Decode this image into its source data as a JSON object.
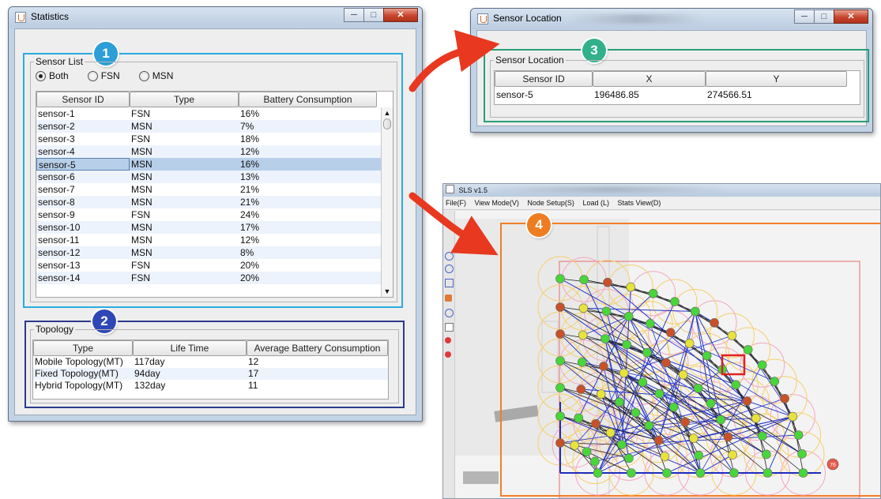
{
  "colors": {
    "highlight_1": "#29abe2",
    "highlight_2": "#2b3a8c",
    "highlight_3": "#2a9d78",
    "highlight_4": "#f07f27",
    "badge_1": "#2c9ed8",
    "badge_2": "#2f47b6",
    "badge_3": "#31b08a",
    "badge_4": "#ee7d22",
    "arrow": "#e8381f",
    "selected_row": "#b8cfe9"
  },
  "statistics": {
    "title": "Statistics",
    "sensor_list": {
      "label": "Sensor List",
      "badge": "1",
      "filter_options": [
        "Both",
        "FSN",
        "MSN"
      ],
      "selected_filter": "Both",
      "columns": [
        "Sensor ID",
        "Type",
        "Battery Consumption"
      ],
      "rows": [
        [
          "sensor-1",
          "FSN",
          "16%"
        ],
        [
          "sensor-2",
          "MSN",
          "7%"
        ],
        [
          "sensor-3",
          "FSN",
          "18%"
        ],
        [
          "sensor-4",
          "MSN",
          "12%"
        ],
        [
          "sensor-5",
          "MSN",
          "16%"
        ],
        [
          "sensor-6",
          "MSN",
          "13%"
        ],
        [
          "sensor-7",
          "MSN",
          "21%"
        ],
        [
          "sensor-8",
          "MSN",
          "21%"
        ],
        [
          "sensor-9",
          "FSN",
          "24%"
        ],
        [
          "sensor-10",
          "MSN",
          "17%"
        ],
        [
          "sensor-11",
          "MSN",
          "12%"
        ],
        [
          "sensor-12",
          "MSN",
          "8%"
        ],
        [
          "sensor-13",
          "FSN",
          "20%"
        ],
        [
          "sensor-14",
          "FSN",
          "20%"
        ]
      ],
      "selected_row_index": 4
    },
    "topology": {
      "label": "Topology",
      "badge": "2",
      "columns": [
        "Type",
        "Life Time",
        "Average Battery Consumption"
      ],
      "rows": [
        [
          "Mobile Topology(MT)",
          "117day",
          "12"
        ],
        [
          "Fixed Topology(MT)",
          "94day",
          "17"
        ],
        [
          "Hybrid Topology(MT)",
          "132day",
          "11"
        ]
      ]
    }
  },
  "sensor_location": {
    "title": "Sensor Location",
    "group_label": "Sensor Location",
    "badge": "3",
    "columns": [
      "Sensor ID",
      "X",
      "Y"
    ],
    "rows": [
      [
        "sensor-5",
        "196486.85",
        "274566.51"
      ]
    ]
  },
  "sls": {
    "title": "SLS v1.5",
    "badge": "4",
    "menu": [
      "File(F)",
      "View Mode(V)",
      "Node Setup(S)",
      "Load (L)",
      "Stats View(D)"
    ],
    "node_labels": [
      "76"
    ]
  }
}
